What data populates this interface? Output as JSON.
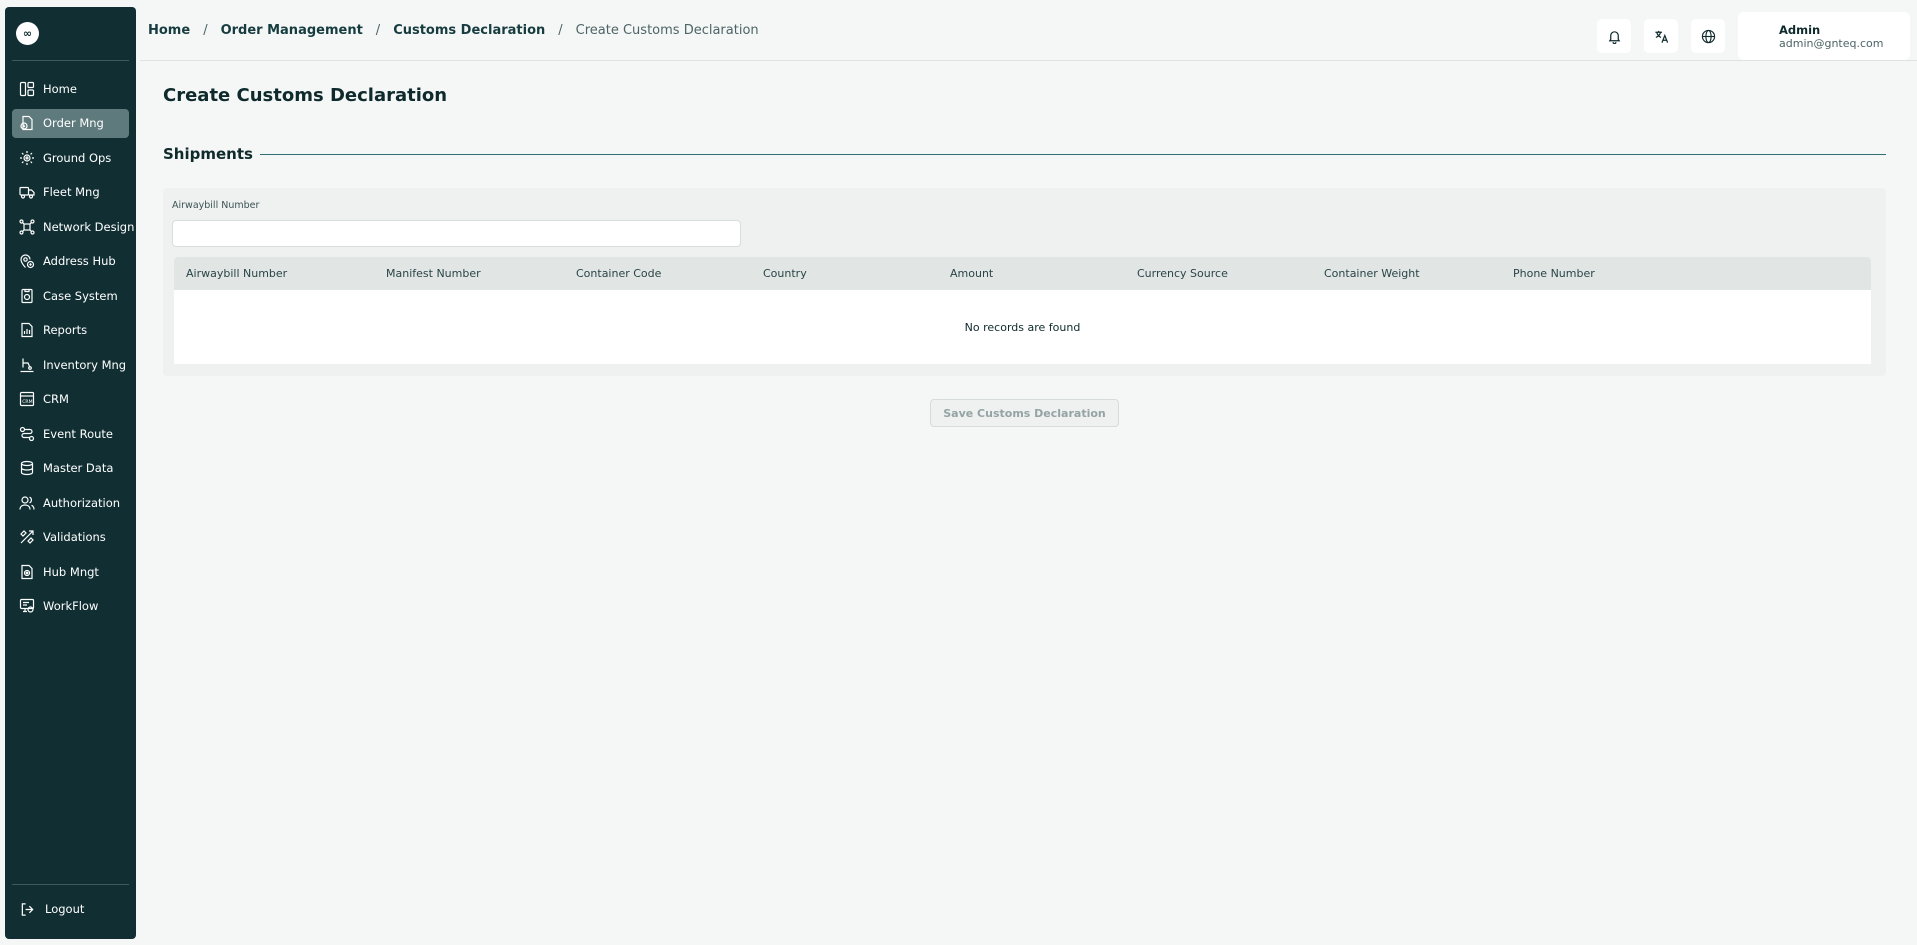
{
  "logo": {
    "glyph": "∞"
  },
  "sidebar": {
    "items": [
      {
        "label": "Home",
        "icon": "home-icon"
      },
      {
        "label": "Order Mng",
        "icon": "order-icon",
        "active": true
      },
      {
        "label": "Ground Ops",
        "icon": "ground-ops-icon"
      },
      {
        "label": "Fleet Mng",
        "icon": "truck-icon"
      },
      {
        "label": "Network Design",
        "icon": "network-icon"
      },
      {
        "label": "Address Hub",
        "icon": "address-icon"
      },
      {
        "label": "Case System",
        "icon": "case-icon"
      },
      {
        "label": "Reports",
        "icon": "reports-icon"
      },
      {
        "label": "Inventory Mng",
        "icon": "inventory-icon"
      },
      {
        "label": "CRM",
        "icon": "crm-icon"
      },
      {
        "label": "Event Route",
        "icon": "route-icon"
      },
      {
        "label": "Master Data",
        "icon": "database-icon"
      },
      {
        "label": "Authorization",
        "icon": "users-icon"
      },
      {
        "label": "Validations",
        "icon": "validations-icon"
      },
      {
        "label": "Hub Mngt",
        "icon": "hub-icon"
      },
      {
        "label": "WorkFlow",
        "icon": "workflow-icon"
      }
    ],
    "logout": "Logout"
  },
  "header": {
    "breadcrumb": [
      "Home",
      "Order Management",
      "Customs Declaration",
      "Create Customs Declaration"
    ],
    "separator": "/",
    "user": {
      "name": "Admin",
      "email": "admin@gnteq.com"
    }
  },
  "main": {
    "title": "Create Customs Declaration",
    "section": "Shipments",
    "filter": {
      "label": "Airwaybill Number",
      "value": "",
      "placeholder": ""
    },
    "table": {
      "columns": [
        "Airwaybill Number",
        "Manifest Number",
        "Container Code",
        "Country",
        "Amount",
        "Currency Source",
        "Container Weight",
        "Phone Number"
      ],
      "empty_text": "No records are found"
    },
    "save_label": "Save Customs Declaration"
  },
  "colors": {
    "sidebar_bg": "#112f33",
    "active_item": "#5e7a7c",
    "accent_line": "#2f6e73"
  }
}
